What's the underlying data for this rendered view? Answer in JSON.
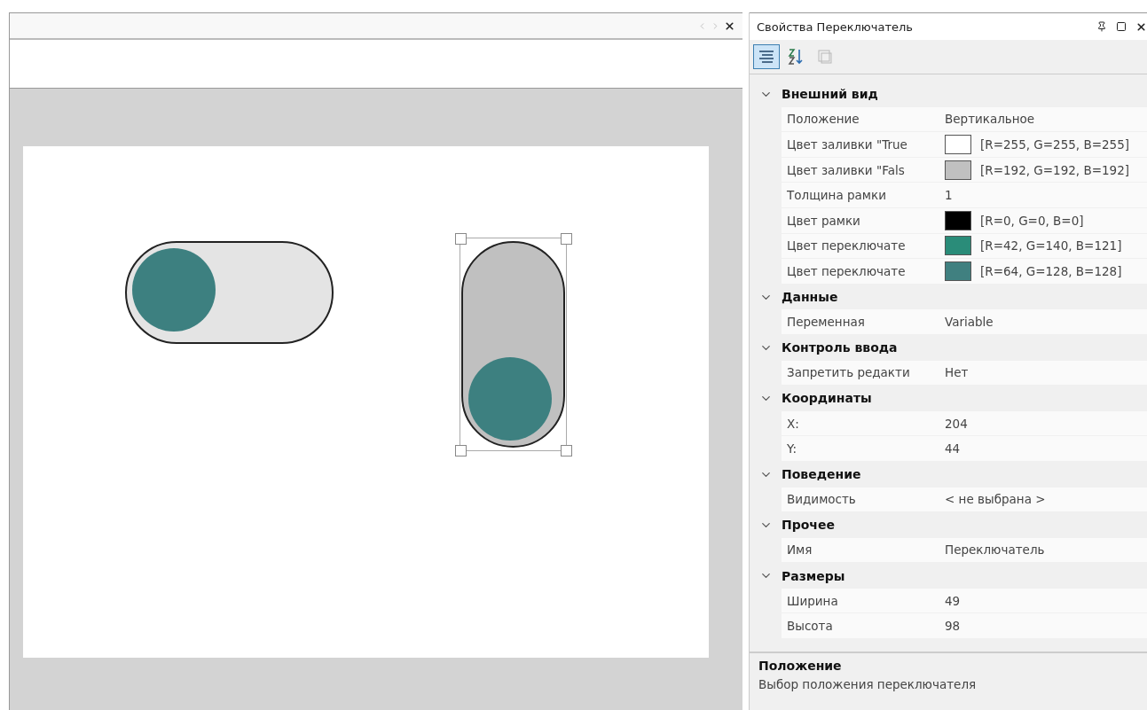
{
  "editor": {
    "switches": [
      {
        "kind": "horizontal",
        "on": false,
        "selected": false
      },
      {
        "kind": "vertical",
        "on": false,
        "selected": true
      }
    ]
  },
  "properties": {
    "title": "Свойства Переключатель",
    "toolbar": [
      {
        "kind": "categorized",
        "selected": true,
        "disabled": false
      },
      {
        "kind": "alphabetical",
        "selected": false,
        "disabled": false
      },
      {
        "kind": "pages",
        "selected": false,
        "disabled": true
      }
    ],
    "categories": [
      {
        "name": "Внешний вид",
        "expanded": true,
        "rows": [
          {
            "name": "Положение",
            "value": "Вертикальное"
          },
          {
            "name": "Цвет заливки \"True",
            "value": "[R=255, G=255, B=255]",
            "color": "#ffffff"
          },
          {
            "name": "Цвет заливки \"Fals",
            "value": "[R=192, G=192, B=192]",
            "color": "#c0c0c0"
          },
          {
            "name": "Толщина рамки",
            "value": "1"
          },
          {
            "name": "Цвет рамки",
            "value": "[R=0, G=0, B=0]",
            "color": "#000000"
          },
          {
            "name": "Цвет переключате",
            "value": "[R=42, G=140, B=121]",
            "color": "#2a8c79"
          },
          {
            "name": "Цвет переключате",
            "value": "[R=64, G=128, B=128]",
            "color": "#408080"
          }
        ]
      },
      {
        "name": "Данные",
        "expanded": true,
        "rows": [
          {
            "name": "Переменная",
            "value": "Variable"
          }
        ]
      },
      {
        "name": "Контроль ввода",
        "expanded": true,
        "rows": [
          {
            "name": "Запретить редакти",
            "value": "Нет"
          }
        ]
      },
      {
        "name": "Координаты",
        "expanded": true,
        "rows": [
          {
            "name": "X:",
            "value": "204"
          },
          {
            "name": "Y:",
            "value": "44"
          }
        ]
      },
      {
        "name": "Поведение",
        "expanded": true,
        "rows": [
          {
            "name": "Видимость",
            "value": "< не выбрана >"
          }
        ]
      },
      {
        "name": "Прочее",
        "expanded": true,
        "rows": [
          {
            "name": "Имя",
            "value": "Переключатель"
          }
        ]
      },
      {
        "name": "Размеры",
        "expanded": true,
        "rows": [
          {
            "name": "Ширина",
            "value": "49"
          },
          {
            "name": "Высота",
            "value": "98"
          }
        ]
      }
    ],
    "description": {
      "title": "Положение",
      "text": "Выбор положения переключателя"
    }
  }
}
